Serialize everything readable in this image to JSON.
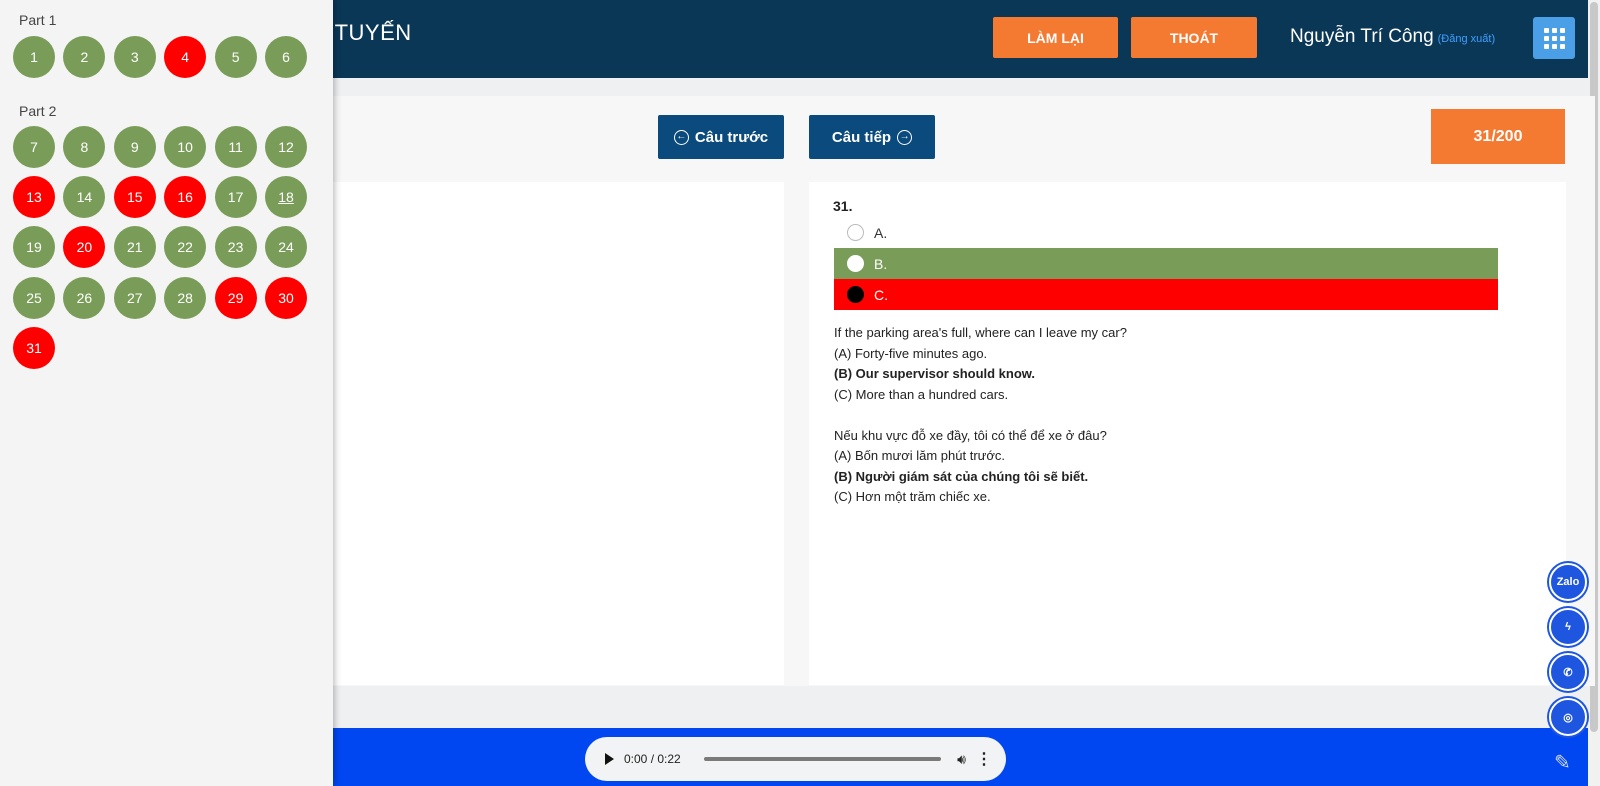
{
  "header": {
    "title": "C TUYẾN",
    "redo_label": "LÀM LẠI",
    "exit_label": "THOÁT",
    "user_name": "Nguyễn Trí Công",
    "logout_label": "(Đăng xuất)"
  },
  "nav": {
    "prev_label": "Câu trước",
    "next_label": "Câu tiếp",
    "counter": "31/200"
  },
  "question": {
    "number": "31.",
    "options": [
      {
        "label": "A.",
        "state": "none"
      },
      {
        "label": "B.",
        "state": "correct"
      },
      {
        "label": "C.",
        "state": "selected-wrong"
      }
    ],
    "explanation_en": {
      "question": "If the parking area's full, where can I leave my car?",
      "a": "(A) Forty-five minutes ago.",
      "b": "(B) Our supervisor should know.",
      "c": "(C) More than a hundred cars."
    },
    "explanation_vi": {
      "question": "Nếu khu vực đỗ xe đầy, tôi có thể để xe ở đâu?",
      "a": "(A) Bốn mươi lăm phút trước.",
      "b": "(B) Người giám sát của chúng tôi sẽ biết.",
      "c": "(C) Hơn một trăm chiếc xe."
    }
  },
  "audio": {
    "time": "0:00 / 0:22"
  },
  "sidebar": {
    "part1_label": "Part 1",
    "part2_label": "Part 2",
    "part1": [
      {
        "n": "1",
        "status": "green"
      },
      {
        "n": "2",
        "status": "green"
      },
      {
        "n": "3",
        "status": "green"
      },
      {
        "n": "4",
        "status": "red"
      },
      {
        "n": "5",
        "status": "green"
      },
      {
        "n": "6",
        "status": "green"
      }
    ],
    "part2": [
      {
        "n": "7",
        "status": "green"
      },
      {
        "n": "8",
        "status": "green"
      },
      {
        "n": "9",
        "status": "green"
      },
      {
        "n": "10",
        "status": "green"
      },
      {
        "n": "11",
        "status": "green"
      },
      {
        "n": "12",
        "status": "green"
      },
      {
        "n": "13",
        "status": "red"
      },
      {
        "n": "14",
        "status": "green"
      },
      {
        "n": "15",
        "status": "red"
      },
      {
        "n": "16",
        "status": "red"
      },
      {
        "n": "17",
        "status": "green"
      },
      {
        "n": "18",
        "status": "green"
      },
      {
        "n": "19",
        "status": "green"
      },
      {
        "n": "20",
        "status": "red"
      },
      {
        "n": "21",
        "status": "green"
      },
      {
        "n": "22",
        "status": "green"
      },
      {
        "n": "23",
        "status": "green"
      },
      {
        "n": "24",
        "status": "green"
      },
      {
        "n": "25",
        "status": "green"
      },
      {
        "n": "26",
        "status": "green"
      },
      {
        "n": "27",
        "status": "green"
      },
      {
        "n": "28",
        "status": "green"
      },
      {
        "n": "29",
        "status": "red"
      },
      {
        "n": "30",
        "status": "red"
      },
      {
        "n": "31",
        "status": "red"
      }
    ]
  },
  "social": {
    "zalo": "Zalo"
  },
  "colors": {
    "header_bg": "#0b3757",
    "orange": "#f47a32",
    "correct_green": "#799d58",
    "wrong_red": "#ff0000",
    "footer_blue": "#0047f2",
    "nav_blue": "#0b4a7c"
  },
  "icons": {
    "apps": "grid-icon",
    "prev": "arrow-left-circle-icon",
    "next": "arrow-right-circle-icon",
    "play": "play-icon",
    "volume": "volume-icon",
    "more": "more-vert-icon",
    "zalo": "zalo-icon",
    "messenger": "messenger-icon",
    "phone": "phone-icon",
    "instagram": "instagram-icon",
    "note": "note-icon"
  }
}
